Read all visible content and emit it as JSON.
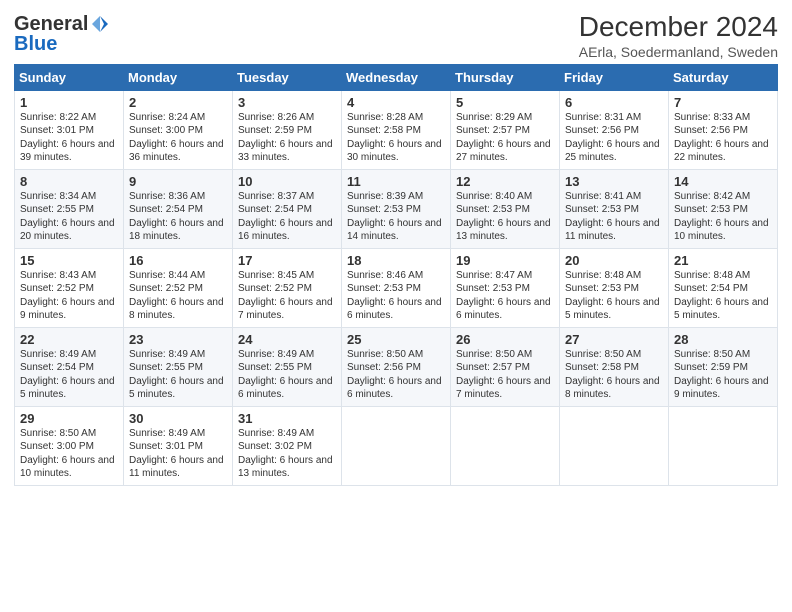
{
  "header": {
    "logo_general": "General",
    "logo_blue": "Blue",
    "title": "December 2024",
    "subtitle": "AErla, Soedermanland, Sweden"
  },
  "weekdays": [
    "Sunday",
    "Monday",
    "Tuesday",
    "Wednesday",
    "Thursday",
    "Friday",
    "Saturday"
  ],
  "weeks": [
    [
      {
        "day": "1",
        "sunrise": "Sunrise: 8:22 AM",
        "sunset": "Sunset: 3:01 PM",
        "daylight": "Daylight: 6 hours and 39 minutes."
      },
      {
        "day": "2",
        "sunrise": "Sunrise: 8:24 AM",
        "sunset": "Sunset: 3:00 PM",
        "daylight": "Daylight: 6 hours and 36 minutes."
      },
      {
        "day": "3",
        "sunrise": "Sunrise: 8:26 AM",
        "sunset": "Sunset: 2:59 PM",
        "daylight": "Daylight: 6 hours and 33 minutes."
      },
      {
        "day": "4",
        "sunrise": "Sunrise: 8:28 AM",
        "sunset": "Sunset: 2:58 PM",
        "daylight": "Daylight: 6 hours and 30 minutes."
      },
      {
        "day": "5",
        "sunrise": "Sunrise: 8:29 AM",
        "sunset": "Sunset: 2:57 PM",
        "daylight": "Daylight: 6 hours and 27 minutes."
      },
      {
        "day": "6",
        "sunrise": "Sunrise: 8:31 AM",
        "sunset": "Sunset: 2:56 PM",
        "daylight": "Daylight: 6 hours and 25 minutes."
      },
      {
        "day": "7",
        "sunrise": "Sunrise: 8:33 AM",
        "sunset": "Sunset: 2:56 PM",
        "daylight": "Daylight: 6 hours and 22 minutes."
      }
    ],
    [
      {
        "day": "8",
        "sunrise": "Sunrise: 8:34 AM",
        "sunset": "Sunset: 2:55 PM",
        "daylight": "Daylight: 6 hours and 20 minutes."
      },
      {
        "day": "9",
        "sunrise": "Sunrise: 8:36 AM",
        "sunset": "Sunset: 2:54 PM",
        "daylight": "Daylight: 6 hours and 18 minutes."
      },
      {
        "day": "10",
        "sunrise": "Sunrise: 8:37 AM",
        "sunset": "Sunset: 2:54 PM",
        "daylight": "Daylight: 6 hours and 16 minutes."
      },
      {
        "day": "11",
        "sunrise": "Sunrise: 8:39 AM",
        "sunset": "Sunset: 2:53 PM",
        "daylight": "Daylight: 6 hours and 14 minutes."
      },
      {
        "day": "12",
        "sunrise": "Sunrise: 8:40 AM",
        "sunset": "Sunset: 2:53 PM",
        "daylight": "Daylight: 6 hours and 13 minutes."
      },
      {
        "day": "13",
        "sunrise": "Sunrise: 8:41 AM",
        "sunset": "Sunset: 2:53 PM",
        "daylight": "Daylight: 6 hours and 11 minutes."
      },
      {
        "day": "14",
        "sunrise": "Sunrise: 8:42 AM",
        "sunset": "Sunset: 2:53 PM",
        "daylight": "Daylight: 6 hours and 10 minutes."
      }
    ],
    [
      {
        "day": "15",
        "sunrise": "Sunrise: 8:43 AM",
        "sunset": "Sunset: 2:52 PM",
        "daylight": "Daylight: 6 hours and 9 minutes."
      },
      {
        "day": "16",
        "sunrise": "Sunrise: 8:44 AM",
        "sunset": "Sunset: 2:52 PM",
        "daylight": "Daylight: 6 hours and 8 minutes."
      },
      {
        "day": "17",
        "sunrise": "Sunrise: 8:45 AM",
        "sunset": "Sunset: 2:52 PM",
        "daylight": "Daylight: 6 hours and 7 minutes."
      },
      {
        "day": "18",
        "sunrise": "Sunrise: 8:46 AM",
        "sunset": "Sunset: 2:53 PM",
        "daylight": "Daylight: 6 hours and 6 minutes."
      },
      {
        "day": "19",
        "sunrise": "Sunrise: 8:47 AM",
        "sunset": "Sunset: 2:53 PM",
        "daylight": "Daylight: 6 hours and 6 minutes."
      },
      {
        "day": "20",
        "sunrise": "Sunrise: 8:48 AM",
        "sunset": "Sunset: 2:53 PM",
        "daylight": "Daylight: 6 hours and 5 minutes."
      },
      {
        "day": "21",
        "sunrise": "Sunrise: 8:48 AM",
        "sunset": "Sunset: 2:54 PM",
        "daylight": "Daylight: 6 hours and 5 minutes."
      }
    ],
    [
      {
        "day": "22",
        "sunrise": "Sunrise: 8:49 AM",
        "sunset": "Sunset: 2:54 PM",
        "daylight": "Daylight: 6 hours and 5 minutes."
      },
      {
        "day": "23",
        "sunrise": "Sunrise: 8:49 AM",
        "sunset": "Sunset: 2:55 PM",
        "daylight": "Daylight: 6 hours and 5 minutes."
      },
      {
        "day": "24",
        "sunrise": "Sunrise: 8:49 AM",
        "sunset": "Sunset: 2:55 PM",
        "daylight": "Daylight: 6 hours and 6 minutes."
      },
      {
        "day": "25",
        "sunrise": "Sunrise: 8:50 AM",
        "sunset": "Sunset: 2:56 PM",
        "daylight": "Daylight: 6 hours and 6 minutes."
      },
      {
        "day": "26",
        "sunrise": "Sunrise: 8:50 AM",
        "sunset": "Sunset: 2:57 PM",
        "daylight": "Daylight: 6 hours and 7 minutes."
      },
      {
        "day": "27",
        "sunrise": "Sunrise: 8:50 AM",
        "sunset": "Sunset: 2:58 PM",
        "daylight": "Daylight: 6 hours and 8 minutes."
      },
      {
        "day": "28",
        "sunrise": "Sunrise: 8:50 AM",
        "sunset": "Sunset: 2:59 PM",
        "daylight": "Daylight: 6 hours and 9 minutes."
      }
    ],
    [
      {
        "day": "29",
        "sunrise": "Sunrise: 8:50 AM",
        "sunset": "Sunset: 3:00 PM",
        "daylight": "Daylight: 6 hours and 10 minutes."
      },
      {
        "day": "30",
        "sunrise": "Sunrise: 8:49 AM",
        "sunset": "Sunset: 3:01 PM",
        "daylight": "Daylight: 6 hours and 11 minutes."
      },
      {
        "day": "31",
        "sunrise": "Sunrise: 8:49 AM",
        "sunset": "Sunset: 3:02 PM",
        "daylight": "Daylight: 6 hours and 13 minutes."
      },
      null,
      null,
      null,
      null
    ]
  ]
}
